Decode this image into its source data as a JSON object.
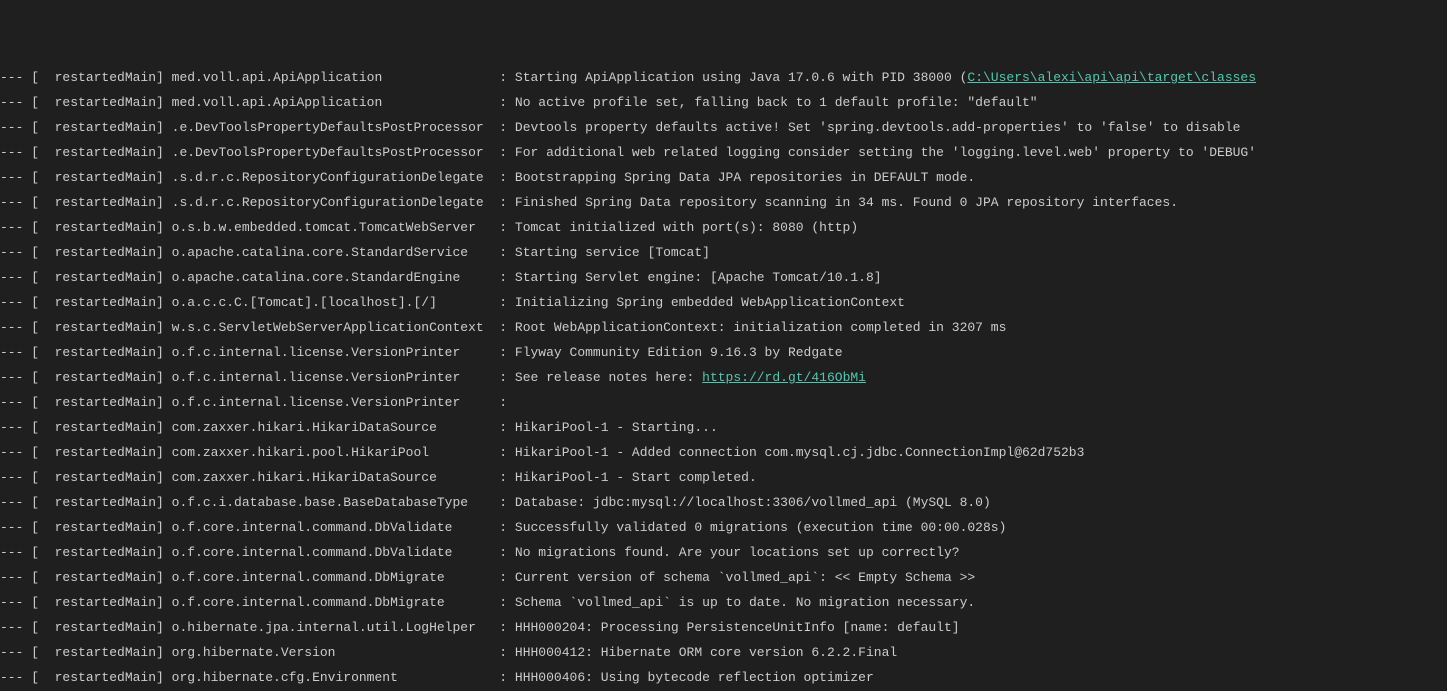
{
  "log_lines": [
    {
      "prefix": "--- [  restartedMain] ",
      "logger": "med.voll.api.ApiApplication              ",
      "sep": " : ",
      "msg_pre": "Starting ApiApplication using Java 17.0.6 with PID 38000 (",
      "link": "C:\\Users\\alexi\\api\\api\\target\\classes",
      "msg_post": ""
    },
    {
      "prefix": "--- [  restartedMain] ",
      "logger": "med.voll.api.ApiApplication              ",
      "sep": " : ",
      "msg": "No active profile set, falling back to 1 default profile: \"default\""
    },
    {
      "prefix": "--- [  restartedMain] ",
      "logger": ".e.DevToolsPropertyDefaultsPostProcessor ",
      "sep": " : ",
      "msg": "Devtools property defaults active! Set 'spring.devtools.add-properties' to 'false' to disable"
    },
    {
      "prefix": "--- [  restartedMain] ",
      "logger": ".e.DevToolsPropertyDefaultsPostProcessor ",
      "sep": " : ",
      "msg": "For additional web related logging consider setting the 'logging.level.web' property to 'DEBUG'"
    },
    {
      "prefix": "--- [  restartedMain] ",
      "logger": ".s.d.r.c.RepositoryConfigurationDelegate ",
      "sep": " : ",
      "msg": "Bootstrapping Spring Data JPA repositories in DEFAULT mode."
    },
    {
      "prefix": "--- [  restartedMain] ",
      "logger": ".s.d.r.c.RepositoryConfigurationDelegate ",
      "sep": " : ",
      "msg": "Finished Spring Data repository scanning in 34 ms. Found 0 JPA repository interfaces."
    },
    {
      "prefix": "--- [  restartedMain] ",
      "logger": "o.s.b.w.embedded.tomcat.TomcatWebServer  ",
      "sep": " : ",
      "msg": "Tomcat initialized with port(s): 8080 (http)"
    },
    {
      "prefix": "--- [  restartedMain] ",
      "logger": "o.apache.catalina.core.StandardService   ",
      "sep": " : ",
      "msg": "Starting service [Tomcat]"
    },
    {
      "prefix": "--- [  restartedMain] ",
      "logger": "o.apache.catalina.core.StandardEngine    ",
      "sep": " : ",
      "msg": "Starting Servlet engine: [Apache Tomcat/10.1.8]"
    },
    {
      "prefix": "--- [  restartedMain] ",
      "logger": "o.a.c.c.C.[Tomcat].[localhost].[/]       ",
      "sep": " : ",
      "msg": "Initializing Spring embedded WebApplicationContext"
    },
    {
      "prefix": "--- [  restartedMain] ",
      "logger": "w.s.c.ServletWebServerApplicationContext ",
      "sep": " : ",
      "msg": "Root WebApplicationContext: initialization completed in 3207 ms"
    },
    {
      "prefix": "--- [  restartedMain] ",
      "logger": "o.f.c.internal.license.VersionPrinter    ",
      "sep": " : ",
      "msg": "Flyway Community Edition 9.16.3 by Redgate"
    },
    {
      "prefix": "--- [  restartedMain] ",
      "logger": "o.f.c.internal.license.VersionPrinter    ",
      "sep": " : ",
      "msg_pre": "See release notes here: ",
      "link": "https://rd.gt/416ObMi",
      "msg_post": ""
    },
    {
      "prefix": "--- [  restartedMain] ",
      "logger": "o.f.c.internal.license.VersionPrinter    ",
      "sep": " : ",
      "msg": ""
    },
    {
      "prefix": "--- [  restartedMain] ",
      "logger": "com.zaxxer.hikari.HikariDataSource       ",
      "sep": " : ",
      "msg": "HikariPool-1 - Starting..."
    },
    {
      "prefix": "--- [  restartedMain] ",
      "logger": "com.zaxxer.hikari.pool.HikariPool        ",
      "sep": " : ",
      "msg": "HikariPool-1 - Added connection com.mysql.cj.jdbc.ConnectionImpl@62d752b3"
    },
    {
      "prefix": "--- [  restartedMain] ",
      "logger": "com.zaxxer.hikari.HikariDataSource       ",
      "sep": " : ",
      "msg": "HikariPool-1 - Start completed."
    },
    {
      "prefix": "--- [  restartedMain] ",
      "logger": "o.f.c.i.database.base.BaseDatabaseType   ",
      "sep": " : ",
      "msg": "Database: jdbc:mysql://localhost:3306/vollmed_api (MySQL 8.0)"
    },
    {
      "prefix": "--- [  restartedMain] ",
      "logger": "o.f.core.internal.command.DbValidate     ",
      "sep": " : ",
      "msg": "Successfully validated 0 migrations (execution time 00:00.028s)"
    },
    {
      "prefix": "--- [  restartedMain] ",
      "logger": "o.f.core.internal.command.DbValidate     ",
      "sep": " : ",
      "msg": "No migrations found. Are your locations set up correctly?"
    },
    {
      "prefix": "--- [  restartedMain] ",
      "logger": "o.f.core.internal.command.DbMigrate      ",
      "sep": " : ",
      "msg": "Current version of schema `vollmed_api`: << Empty Schema >>"
    },
    {
      "prefix": "--- [  restartedMain] ",
      "logger": "o.f.core.internal.command.DbMigrate      ",
      "sep": " : ",
      "msg": "Schema `vollmed_api` is up to date. No migration necessary."
    },
    {
      "prefix": "--- [  restartedMain] ",
      "logger": "o.hibernate.jpa.internal.util.LogHelper  ",
      "sep": " : ",
      "msg": "HHH000204: Processing PersistenceUnitInfo [name: default]"
    },
    {
      "prefix": "--- [  restartedMain] ",
      "logger": "org.hibernate.Version                    ",
      "sep": " : ",
      "msg": "HHH000412: Hibernate ORM core version 6.2.2.Final"
    },
    {
      "prefix": "--- [  restartedMain] ",
      "logger": "org.hibernate.cfg.Environment            ",
      "sep": " : ",
      "msg": "HHH000406: Using bytecode reflection optimizer"
    }
  ]
}
